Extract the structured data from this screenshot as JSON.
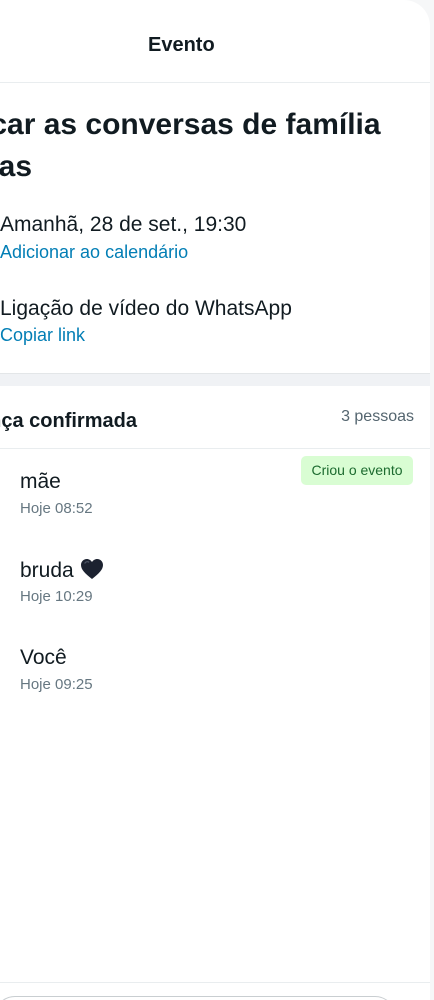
{
  "header": {
    "title": "Evento"
  },
  "event": {
    "title": "ocar as conversas de família\ndias",
    "when": "Amanhã, 28 de set., 19:30",
    "add_calendar": "Adicionar ao calendário",
    "call": "Ligação de vídeo do WhatsApp",
    "copy_link": "Copiar link"
  },
  "attendance": {
    "title": "ença confirmada",
    "count": "3 pessoas",
    "attendees": [
      {
        "name": "mãe",
        "time": "Hoje 08:52",
        "badge": "Criou o evento"
      },
      {
        "name": "bruda",
        "time": "Hoje 10:29",
        "emoji": "dark-heart-icon"
      },
      {
        "name": "Você",
        "time": "Hoje 09:25"
      }
    ]
  },
  "colors": {
    "link": "#027eb5",
    "badge_bg": "#d9fdd3",
    "badge_text": "#1c6b2f",
    "text_primary": "#111b21",
    "text_secondary": "#667781"
  }
}
